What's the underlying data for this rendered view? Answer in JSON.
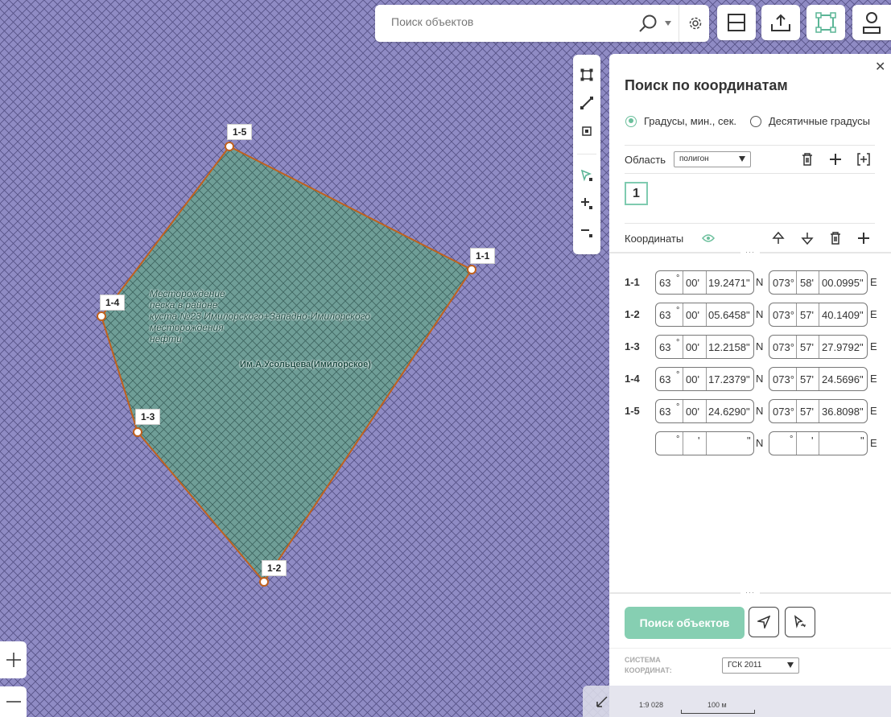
{
  "search": {
    "placeholder": "Поиск объектов"
  },
  "map": {
    "points": [
      {
        "id": "1-1"
      },
      {
        "id": "1-2"
      },
      {
        "id": "1-3"
      },
      {
        "id": "1-4"
      },
      {
        "id": "1-5"
      }
    ],
    "deposit_label": "Месторождение\nпеска в районе\nкуста №23 Имилорского+Западно-Имилорского\nместорождения\nнефти",
    "field_label": "Им.А.Усольцева(Имилорское)",
    "scale": "1:9 028",
    "scale_distance": "100 м"
  },
  "panel": {
    "title": "Поиск по координатам",
    "radio_dms": "Градусы, мин., сек.",
    "radio_decimal": "Десятичные градусы",
    "area_label": "Область",
    "area_type": "полигон",
    "polygon_tab": "1",
    "coords_label": "Координаты",
    "rows": [
      {
        "id": "1-1",
        "lat_d": "63",
        "lat_m": "00'",
        "lat_s": "19.2471\"",
        "lat_h": "N",
        "lon_d": "073°",
        "lon_m": "58'",
        "lon_s": "00.0995\"",
        "lon_h": "E"
      },
      {
        "id": "1-2",
        "lat_d": "63",
        "lat_m": "00'",
        "lat_s": "05.6458\"",
        "lat_h": "N",
        "lon_d": "073°",
        "lon_m": "57'",
        "lon_s": "40.1409\"",
        "lon_h": "E"
      },
      {
        "id": "1-3",
        "lat_d": "63",
        "lat_m": "00'",
        "lat_s": "12.2158\"",
        "lat_h": "N",
        "lon_d": "073°",
        "lon_m": "57'",
        "lon_s": "27.9792\"",
        "lon_h": "E"
      },
      {
        "id": "1-4",
        "lat_d": "63",
        "lat_m": "00'",
        "lat_s": "17.2379\"",
        "lat_h": "N",
        "lon_d": "073°",
        "lon_m": "57'",
        "lon_s": "24.5696\"",
        "lon_h": "E"
      },
      {
        "id": "1-5",
        "lat_d": "63",
        "lat_m": "00'",
        "lat_s": "24.6290\"",
        "lat_h": "N",
        "lon_d": "073°",
        "lon_m": "57'",
        "lon_s": "36.8098\"",
        "lon_h": "E"
      }
    ],
    "empty_row": {
      "lat_h": "N",
      "lon_h": "E"
    },
    "search_button": "Поиск объектов",
    "system_label_1": "СИСТЕМА",
    "system_label_2": "КООРДИНАТ:",
    "system_value": "ГСК 2011"
  },
  "colors": {
    "accent": "#6bbf9c",
    "map_bg": "#8f8bc4",
    "polygon_fill": "#6f9e97",
    "polygon_stroke": "#c0611e"
  }
}
